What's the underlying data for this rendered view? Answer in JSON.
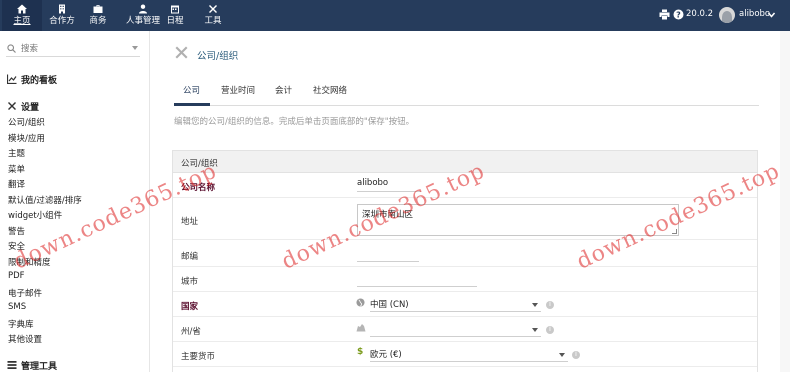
{
  "topnav": {
    "items": [
      {
        "label": "主页",
        "icon": "home-icon"
      },
      {
        "label": "合作方",
        "icon": "building-icon"
      },
      {
        "label": "商务",
        "icon": "briefcase-icon"
      },
      {
        "label": "人事管理",
        "icon": "person-icon"
      },
      {
        "label": "日程",
        "icon": "calendar-icon"
      },
      {
        "label": "工具",
        "icon": "tools-icon"
      }
    ],
    "version": "20.0.2",
    "username": "alibobo"
  },
  "sidebar": {
    "search_placeholder": "搜索",
    "dashboard_label": "我的看板",
    "settings_label": "设置",
    "settings_items": [
      "公司/组织",
      "模块/应用",
      "主题",
      "菜单",
      "翻译",
      "默认值/过滤器/排序",
      "widget小组件",
      "警告",
      "安全",
      "限制和精度",
      "PDF",
      "电子邮件",
      "SMS",
      "字典库",
      "其他设置"
    ],
    "admin_tools_label": "管理工具"
  },
  "main": {
    "title": "公司/组织",
    "tabs": [
      "公司",
      "营业时间",
      "会计",
      "社交网络"
    ],
    "help_text": "编辑您的公司/组织的信息。完成后单击页面底部的\"保存\"按钮。",
    "section_title": "公司/组织",
    "fields": {
      "company_name_label": "公司名称",
      "company_name_value": "alibobo",
      "address_label": "地址",
      "address_value": "深圳市南山区",
      "zip_label": "邮编",
      "zip_value": "",
      "city_label": "城市",
      "city_value": "",
      "country_label": "国家",
      "country_value": "中国 (CN)",
      "state_label": "州/省",
      "state_value": "",
      "currency_label": "主要货币",
      "currency_value": "欧元 (€)",
      "currency_symbol": "$"
    }
  },
  "watermark": "down.code365.top",
  "colors": {
    "topbar": "#263c5c",
    "link": "#2c5d7c",
    "required_label": "#5a0f2e",
    "watermark": "#dd2222"
  }
}
